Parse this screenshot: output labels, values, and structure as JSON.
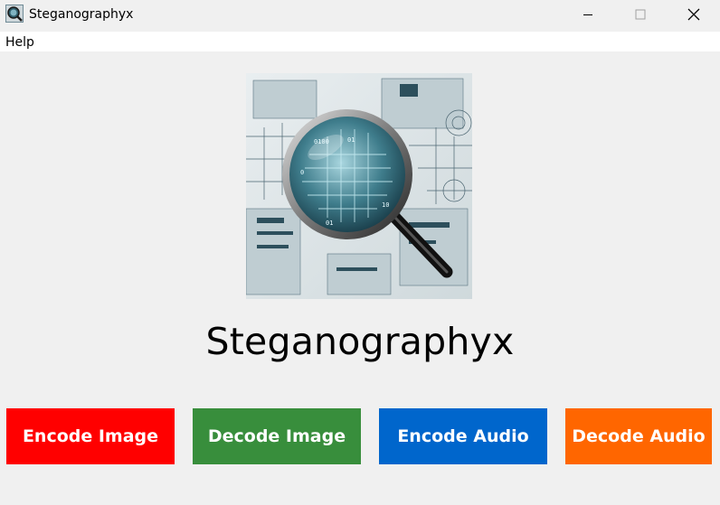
{
  "window": {
    "title": "Steganographyx",
    "icon": "magnifier-circuit-icon"
  },
  "menubar": {
    "items": [
      {
        "label": "Help"
      }
    ]
  },
  "hero": {
    "icon": "magnifying-glass-over-circuit-image"
  },
  "main": {
    "heading": "Steganographyx"
  },
  "actions": [
    {
      "label": "Encode Image",
      "color": "#ff0000"
    },
    {
      "label": "Decode Image",
      "color": "#388e3c"
    },
    {
      "label": "Encode Audio",
      "color": "#0066cc"
    },
    {
      "label": "Decode Audio",
      "color": "#ff6600"
    }
  ]
}
